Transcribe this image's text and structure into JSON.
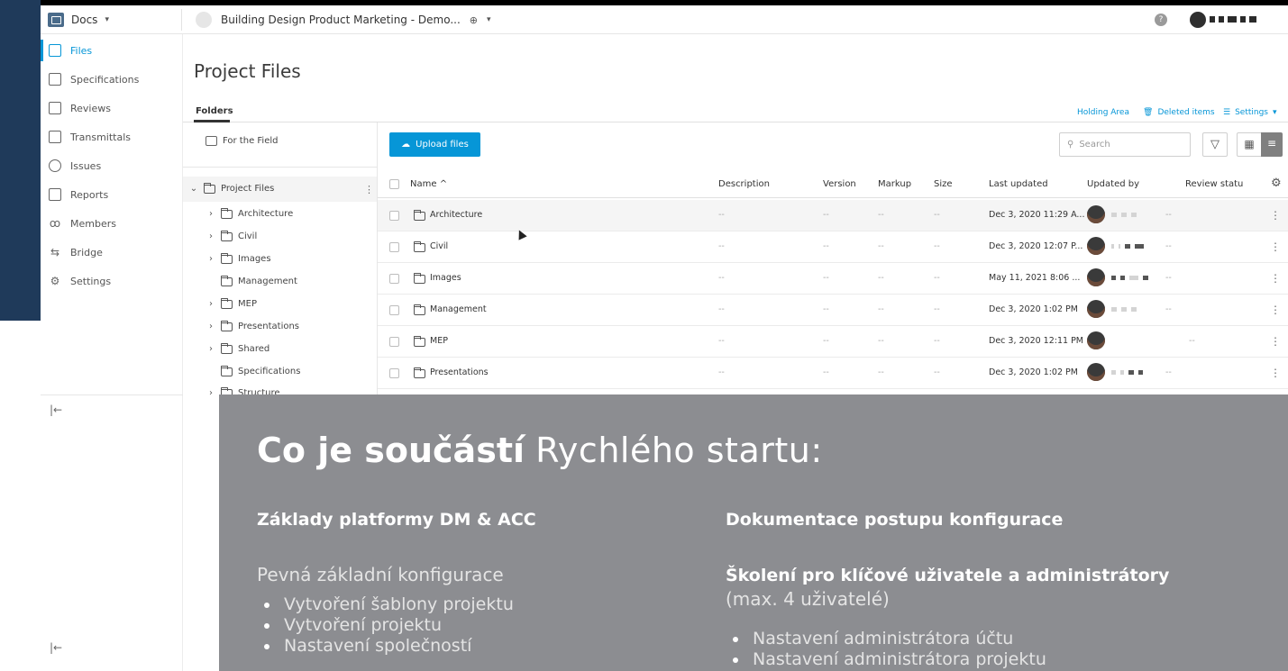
{
  "header": {
    "app_label": "Docs",
    "project_name": "Building Design Product Marketing - Demo...",
    "help_symbol": "?"
  },
  "nav": {
    "items": [
      {
        "label": "Files",
        "icon": "file-icon",
        "active": true
      },
      {
        "label": "Specifications",
        "icon": "specifications-icon"
      },
      {
        "label": "Reviews",
        "icon": "reviews-icon"
      },
      {
        "label": "Transmittals",
        "icon": "transmittals-icon"
      },
      {
        "label": "Issues",
        "icon": "issues-icon"
      },
      {
        "label": "Reports",
        "icon": "reports-icon"
      },
      {
        "label": "Members",
        "icon": "members-icon"
      },
      {
        "label": "Bridge",
        "icon": "bridge-icon"
      },
      {
        "label": "Settings",
        "icon": "gear-icon"
      }
    ],
    "collapse_symbol": "|←"
  },
  "main": {
    "title": "Project Files",
    "tab": "Folders",
    "links": {
      "holding_area": "Holding Area",
      "deleted_items": "Deleted items",
      "settings": "Settings"
    },
    "for_the_field": "For the Field",
    "upload_label": "Upload files",
    "search_placeholder": "Search"
  },
  "tree": {
    "root": "Project Files",
    "children": [
      "Architecture",
      "Civil",
      "Images",
      "Management",
      "MEP",
      "Presentations",
      "Shared",
      "Specifications",
      "Structure"
    ]
  },
  "table": {
    "columns": [
      "Name",
      "Description",
      "Version",
      "Markup",
      "Size",
      "Last updated",
      "Updated by",
      "Review statu"
    ],
    "rows": [
      {
        "name": "Architecture",
        "description": "--",
        "version": "--",
        "markup": "--",
        "size": "--",
        "updated": "Dec 3, 2020 11:29 A...",
        "review": "--"
      },
      {
        "name": "Civil",
        "description": "--",
        "version": "--",
        "markup": "--",
        "size": "--",
        "updated": "Dec 3, 2020 12:07 P...",
        "review": "--"
      },
      {
        "name": "Images",
        "description": "--",
        "version": "--",
        "markup": "--",
        "size": "--",
        "updated": "May 11, 2021 8:06 ...",
        "review": "--"
      },
      {
        "name": "Management",
        "description": "--",
        "version": "--",
        "markup": "--",
        "size": "--",
        "updated": "Dec 3, 2020 1:02 PM",
        "review": "--"
      },
      {
        "name": "MEP",
        "description": "--",
        "version": "--",
        "markup": "--",
        "size": "--",
        "updated": "Dec 3, 2020 12:11 PM",
        "review": "--"
      },
      {
        "name": "Presentations",
        "description": "--",
        "version": "--",
        "markup": "--",
        "size": "--",
        "updated": "Dec 3, 2020 1:02 PM",
        "review": "--"
      }
    ]
  },
  "overlay": {
    "title_bold": "Co je součástí",
    "title_light": "Rychlého startu:",
    "left_heading": "Základy platformy DM & ACC",
    "left_subheading": "Pevná základní konfigurace",
    "left_items": [
      "Vytvoření šablony projektu",
      "Vytvoření projektu",
      "Nastavení společností"
    ],
    "right_heading": "Dokumentace postupu konfigurace",
    "right_heading2": "Školení pro klíčové uživatele a administrátory",
    "right_note": "(max. 4 uživatelé)",
    "right_items": [
      "Nastavení administrátora účtu",
      "Nastavení administrátora projektu"
    ]
  },
  "colors": {
    "accent": "#0696d7",
    "overlay_bg": "#8c8d91",
    "dark_strip": "#1f3a5a"
  }
}
